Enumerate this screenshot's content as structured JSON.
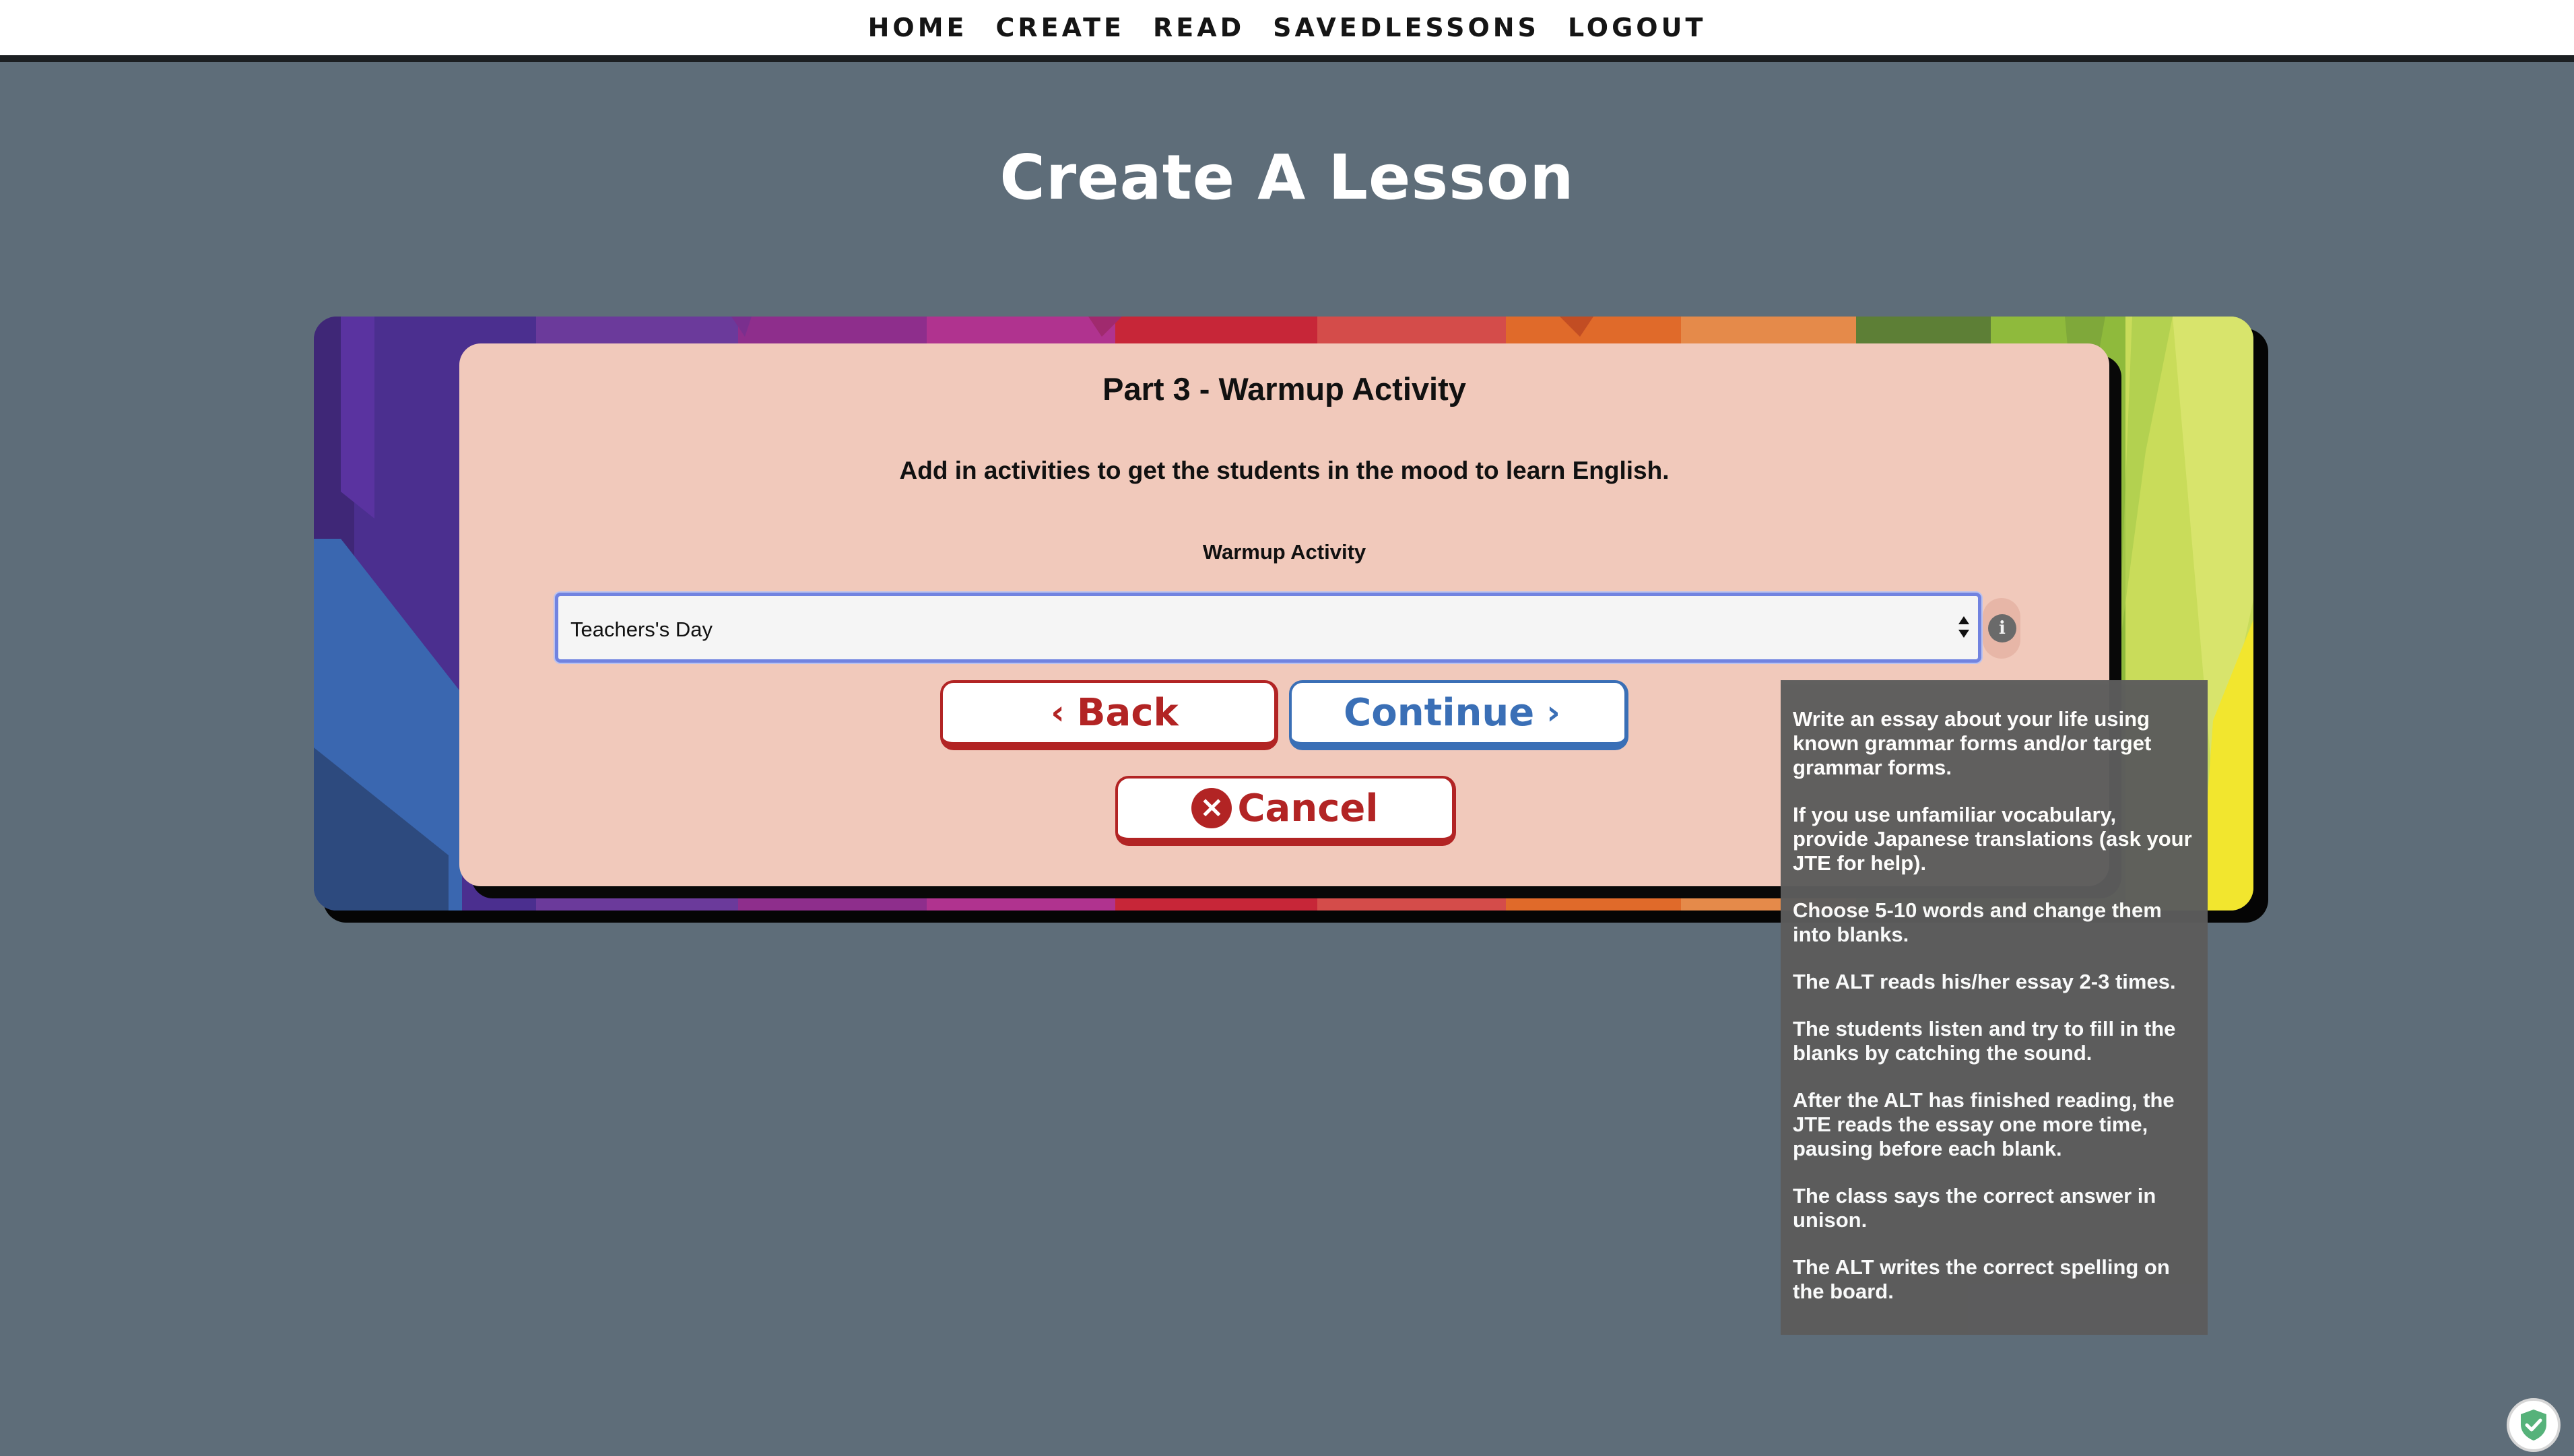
{
  "nav": {
    "items": [
      {
        "label": "HOME"
      },
      {
        "label": "CREATE"
      },
      {
        "label": "READ"
      },
      {
        "label": "SAVEDLESSONS"
      },
      {
        "label": "LOGOUT"
      }
    ]
  },
  "page": {
    "title": "Create A Lesson"
  },
  "card": {
    "title": "Part 3 - Warmup Activity",
    "description": "Add in activities to get the students in the mood to learn English.",
    "field_label": "Warmup Activity",
    "select_value": "Teachers's Day",
    "info_icon": "info-icon"
  },
  "buttons": {
    "back_label": "Back",
    "continue_label": "Continue",
    "cancel_label": "Cancel"
  },
  "tooltip": {
    "paragraphs": [
      "Write an essay about your life using known grammar forms and/or target grammar forms.",
      "If you use unfamiliar vocabulary, provide Japanese translations (ask your JTE for help).",
      "Choose 5-10 words and change them into blanks.",
      "The ALT reads his/her essay 2-3 times.",
      "The students listen and try to fill in the blanks by catching the sound.",
      "After the ALT has finished reading, the JTE reads the essay one more time, pausing before each blank.",
      "The class says the correct answer in unison.",
      "The ALT writes the correct spelling on the board."
    ]
  },
  "colors": {
    "background": "#5e6d79",
    "card": "#f1c9bb",
    "accent_red": "#b22424",
    "accent_blue": "#3a6fb6",
    "select_border": "#7183e0",
    "tooltip_bg": "#5c5c5c"
  },
  "icons": {
    "back": "chevron-left-icon",
    "continue": "chevron-right-icon",
    "cancel": "close-circle-icon",
    "corner": "shield-check-icon"
  }
}
